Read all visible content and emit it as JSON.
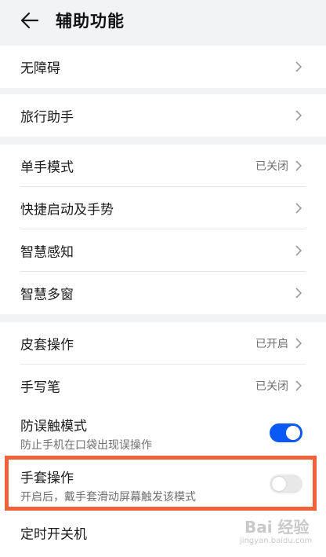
{
  "header": {
    "title": "辅助功能"
  },
  "groups": [
    {
      "rows": [
        {
          "label": "无障碍"
        }
      ]
    },
    {
      "rows": [
        {
          "label": "旅行助手"
        }
      ]
    },
    {
      "rows": [
        {
          "label": "单手模式",
          "status": "已关闭"
        },
        {
          "label": "快捷启动及手势"
        },
        {
          "label": "智慧感知"
        },
        {
          "label": "智慧多窗"
        }
      ]
    },
    {
      "rows": [
        {
          "label": "皮套操作",
          "status": "已开启"
        },
        {
          "label": "手写笔",
          "status": "已关闭"
        },
        {
          "label": "防误触模式",
          "desc": "防止手机在口袋出现误操作",
          "toggle": true
        },
        {
          "label": "手套操作",
          "desc": "开启后，戴手套滑动屏幕触发该模式",
          "toggle": false
        },
        {
          "label": "定时开关机"
        }
      ]
    }
  ],
  "colors": {
    "toggle_on": "#0a59f7",
    "highlight": "#f0623a"
  },
  "watermark": {
    "text": "Bai 经验",
    "sub": "jingyan.baidu.com"
  }
}
